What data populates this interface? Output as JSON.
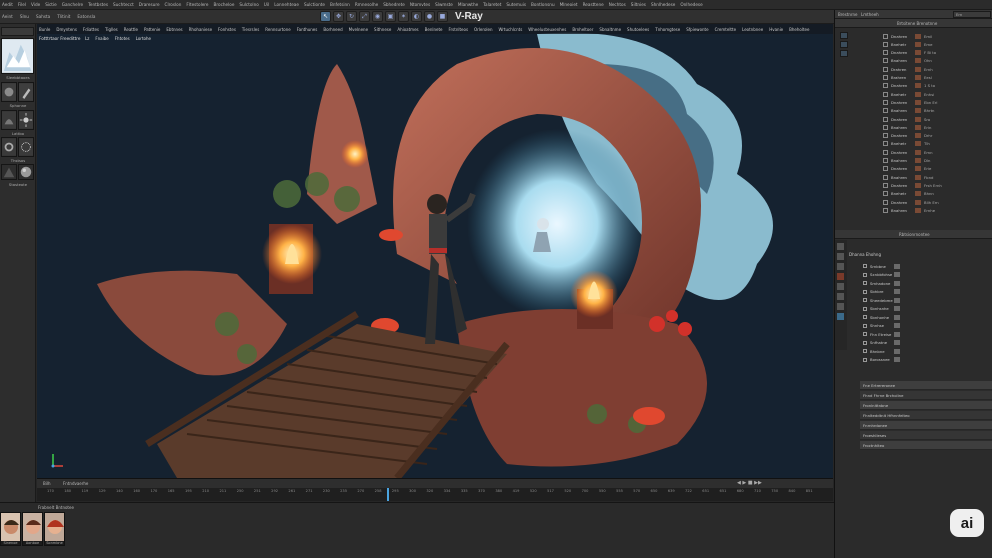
{
  "menubar": {
    "items": [
      "Aedit",
      "Filel",
      "Vide",
      "Sictie",
      "Ganchelre",
      "Tentbstes",
      "Suchtecct",
      "Draresure",
      "Clroslon",
      "Fltestolere",
      "Brocheloe",
      "Sulctolno",
      "Uil",
      "Lonnehteae",
      "Sulctionte",
      "Bnfetsinn",
      "Rmnesolhe",
      "Sbhedrete",
      "Ntomvtes",
      "Slwmste",
      "Mlanwthe",
      "Talaretet",
      "Sutemuis",
      "Bontlonsnu",
      "Mlneoiet",
      "Reasttene",
      "Nechtos",
      "Siltnies",
      "Shnlhedese",
      "Onlhedese"
    ]
  },
  "toolbar": {
    "items": [
      "Aeint",
      "Slnu",
      "Sahsta",
      "Tlitinit",
      "Eatonsla"
    ],
    "title": "V-Ray",
    "tool_icons": [
      "cursor-icon",
      "move-icon",
      "rotate-icon",
      "scale-icon",
      "render-icon",
      "camera-icon",
      "light-icon",
      "material-icon",
      "sphere-icon",
      "cube-icon"
    ],
    "active_tool": 0
  },
  "left_panel": {
    "items": [
      "Sleebbtaoes",
      "Sphonne",
      "Lattbo",
      "Thstsos",
      "Strllt",
      "Stasteote"
    ]
  },
  "viewport": {
    "strip_items": [
      "Bunle",
      "Dmyntens",
      "Fdiattes",
      "Tiglles",
      "Reattle",
      "Pattenie",
      "Ebtnnes",
      "Rhohaniese",
      "Fonhstes",
      "Tiesrsles",
      "Rennsurtone",
      "Fanthunes",
      "Borhneed",
      "Mvelnene",
      "Sithnese",
      "Ahioatmes",
      "Benlnete",
      "Frstnlteos",
      "Orlerolen",
      "Wrtuchlcnts",
      "Wheelusteuxenhes",
      "Brnheltoer",
      "Sbnaltnme",
      "Shutoelees",
      "Tnhomgtese",
      "Sfpiewonte",
      "Cremteltte",
      "Leotnbnee",
      "Hvanie",
      "Bheholtee"
    ],
    "sub_items": [
      "Lz",
      "Fnaibe",
      "Fhtotes",
      "Lortohe"
    ],
    "caption": "Fotttrtaor Freedittre"
  },
  "timeline": {
    "bar_label": "Fntndvaerhe",
    "left_field": "Bilh",
    "ticks": [
      "170",
      "180",
      "119",
      "129",
      "140",
      "160",
      "170",
      "165",
      "195",
      "210",
      "211",
      "250",
      "251",
      "292",
      "261",
      "271",
      "230",
      "235",
      "270",
      "258",
      "295",
      "300",
      "320",
      "334",
      "335",
      "370",
      "380",
      "419",
      "520",
      "517",
      "520",
      "700",
      "550",
      "555",
      "570",
      "650",
      "639",
      "722",
      "651",
      "651",
      "680",
      "710",
      "750",
      "840",
      "851"
    ],
    "playhead": 0.44
  },
  "bottom_panel": {
    "title": "Frabnelt  Bntnotee",
    "avatars": [
      "Sinenoe",
      "Aonboe",
      "Sonmbne",
      "Sarithone"
    ]
  },
  "right_panel": {
    "top_tabs": [
      "Brestnrne",
      "Lmtheeh"
    ],
    "top_field": "Ern",
    "outliner_title": "Brtsitene Brenotnne",
    "outliner_rows": [
      {
        "name": "Dnahren",
        "val": "Emil"
      },
      {
        "name": "Bnehetr",
        "val": "Eme"
      },
      {
        "name": "Dnahren",
        "val": "F Bi to"
      },
      {
        "name": "Bnahren",
        "val": "Ohn"
      },
      {
        "name": "Drahren",
        "val": "Ernh"
      },
      {
        "name": "Brahren",
        "val": "Eesl"
      },
      {
        "name": "Dnahren",
        "val": "1 S to"
      },
      {
        "name": "Bnehetr",
        "val": "Enhsi"
      },
      {
        "name": "Dnahren",
        "val": "Ebn Erl"
      },
      {
        "name": "Bnahren",
        "val": "Bhrtn"
      },
      {
        "name": "Dnahren",
        "val": "Sro"
      },
      {
        "name": "Bnahren",
        "val": "Erin"
      },
      {
        "name": "Dnahren",
        "val": "Drhr"
      },
      {
        "name": "Bnehetr",
        "val": "Tlh"
      },
      {
        "name": "Dnahren",
        "val": "Emn"
      },
      {
        "name": "Bnahren",
        "val": "Dln"
      },
      {
        "name": "Dnahren",
        "val": "Erie"
      },
      {
        "name": "Bnahren",
        "val": "Fbnd"
      },
      {
        "name": "Dnahren",
        "val": "Frsh Ernh"
      },
      {
        "name": "Bnehetr",
        "val": "Bhnn"
      },
      {
        "name": "Dnahren",
        "val": "Bllh Ern"
      },
      {
        "name": "Bnahren",
        "val": "Ernhe"
      }
    ],
    "attributes_title": "Rbtsionrnontee",
    "attributes_header": "Dhanna Ehohng",
    "attributes": [
      "Srnbbne",
      "Sxnbbfohse",
      "Smhadone",
      "Sbhbre",
      "Sheedebme",
      "Sbnhsnhe",
      "Sbnhonhe",
      "Shnhse",
      "Fhn Etreise",
      "Snfhatne",
      "Bhnbne",
      "Borossnee"
    ],
    "property_rows": [
      "Fne Ertrereronee",
      "Fhnd Fhrne Brcholine",
      "Fronlnittnbne",
      "Fhnlteddtnit Hfhnnfelteo",
      "Fnrnhrdonee",
      "Froeshlleses",
      "Froctnhlteo"
    ]
  },
  "badge": "ai",
  "colors": {
    "accent": "#4aa3df",
    "scene_bg": "#152230",
    "rock": "#a0594a",
    "portal": "#a9dcef",
    "flame": "#ffb347"
  }
}
